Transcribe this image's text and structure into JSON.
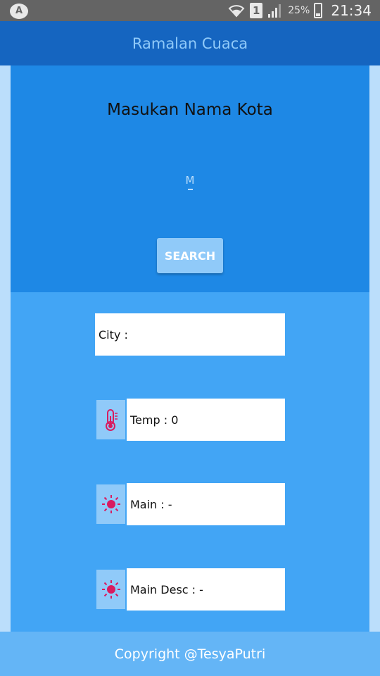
{
  "status_bar": {
    "sim_label": "1",
    "battery_text": "25%",
    "time": "21:34",
    "android_icon": "A"
  },
  "app_bar": {
    "title": "Ramalan Cuaca"
  },
  "search": {
    "heading": "Masukan Nama Kota",
    "input_value": "M",
    "button_label": "SEARCH"
  },
  "results": {
    "city": "City :",
    "temp": "Temp : 0",
    "main": "Main : -",
    "main_desc": "Main Desc : -"
  },
  "footer": {
    "text": "Copyright @TesyaPutri"
  },
  "colors": {
    "accent": "#d81b60",
    "app_bar": "#1565c0",
    "search_panel": "#1e88e5",
    "result_panel": "#42a5f5",
    "footer": "#64b5f6"
  },
  "icons": {
    "temp": "thermometer-icon",
    "main": "sun-icon",
    "main_desc": "sun-icon"
  }
}
